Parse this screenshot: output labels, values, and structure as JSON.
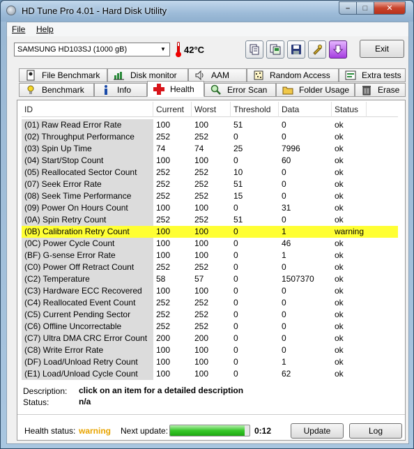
{
  "window": {
    "title": "HD Tune Pro 4.01 - Hard Disk Utility",
    "min_glyph": "–",
    "max_glyph": "□",
    "close_glyph": "✕"
  },
  "menu": {
    "file": "File",
    "help": "Help"
  },
  "toolbar": {
    "drive": "SAMSUNG HD103SJ (1000 gB)",
    "temperature": "42°C",
    "exit_label": "Exit"
  },
  "tabs_top": [
    {
      "label": "File Benchmark",
      "icon": "file-benchmark-icon"
    },
    {
      "label": "Disk monitor",
      "icon": "disk-monitor-icon"
    },
    {
      "label": "AAM",
      "icon": "speaker-icon"
    },
    {
      "label": "Random Access",
      "icon": "random-access-icon"
    },
    {
      "label": "Extra tests",
      "icon": "extra-tests-icon"
    }
  ],
  "tabs_bottom": [
    {
      "label": "Benchmark",
      "icon": "bulb-icon"
    },
    {
      "label": "Info",
      "icon": "info-icon"
    },
    {
      "label": "Health",
      "icon": "health-cross-icon",
      "active": true
    },
    {
      "label": "Error Scan",
      "icon": "magnifier-icon"
    },
    {
      "label": "Folder Usage",
      "icon": "folder-icon"
    },
    {
      "label": "Erase",
      "icon": "trash-icon"
    }
  ],
  "columns": [
    "ID",
    "Current",
    "Worst",
    "Threshold",
    "Data",
    "Status"
  ],
  "rows": [
    {
      "id": "(01) Raw Read Error Rate",
      "current": "100",
      "worst": "100",
      "threshold": "51",
      "data": "0",
      "status": "ok"
    },
    {
      "id": "(02) Throughput Performance",
      "current": "252",
      "worst": "252",
      "threshold": "0",
      "data": "0",
      "status": "ok"
    },
    {
      "id": "(03) Spin Up Time",
      "current": "74",
      "worst": "74",
      "threshold": "25",
      "data": "7996",
      "status": "ok"
    },
    {
      "id": "(04) Start/Stop Count",
      "current": "100",
      "worst": "100",
      "threshold": "0",
      "data": "60",
      "status": "ok"
    },
    {
      "id": "(05) Reallocated Sector Count",
      "current": "252",
      "worst": "252",
      "threshold": "10",
      "data": "0",
      "status": "ok"
    },
    {
      "id": "(07) Seek Error Rate",
      "current": "252",
      "worst": "252",
      "threshold": "51",
      "data": "0",
      "status": "ok"
    },
    {
      "id": "(08) Seek Time Performance",
      "current": "252",
      "worst": "252",
      "threshold": "15",
      "data": "0",
      "status": "ok"
    },
    {
      "id": "(09) Power On Hours Count",
      "current": "100",
      "worst": "100",
      "threshold": "0",
      "data": "31",
      "status": "ok"
    },
    {
      "id": "(0A) Spin Retry Count",
      "current": "252",
      "worst": "252",
      "threshold": "51",
      "data": "0",
      "status": "ok"
    },
    {
      "id": "(0B) Calibration Retry Count",
      "current": "100",
      "worst": "100",
      "threshold": "0",
      "data": "1",
      "status": "warning"
    },
    {
      "id": "(0C) Power Cycle Count",
      "current": "100",
      "worst": "100",
      "threshold": "0",
      "data": "46",
      "status": "ok"
    },
    {
      "id": "(BF) G-sense Error Rate",
      "current": "100",
      "worst": "100",
      "threshold": "0",
      "data": "1",
      "status": "ok"
    },
    {
      "id": "(C0) Power Off Retract Count",
      "current": "252",
      "worst": "252",
      "threshold": "0",
      "data": "0",
      "status": "ok"
    },
    {
      "id": "(C2) Temperature",
      "current": "58",
      "worst": "57",
      "threshold": "0",
      "data": "1507370",
      "status": "ok"
    },
    {
      "id": "(C3) Hardware ECC Recovered",
      "current": "100",
      "worst": "100",
      "threshold": "0",
      "data": "0",
      "status": "ok"
    },
    {
      "id": "(C4) Reallocated Event Count",
      "current": "252",
      "worst": "252",
      "threshold": "0",
      "data": "0",
      "status": "ok"
    },
    {
      "id": "(C5) Current Pending Sector",
      "current": "252",
      "worst": "252",
      "threshold": "0",
      "data": "0",
      "status": "ok"
    },
    {
      "id": "(C6) Offline Uncorrectable",
      "current": "252",
      "worst": "252",
      "threshold": "0",
      "data": "0",
      "status": "ok"
    },
    {
      "id": "(C7) Ultra DMA CRC Error Count",
      "current": "200",
      "worst": "200",
      "threshold": "0",
      "data": "0",
      "status": "ok"
    },
    {
      "id": "(C8) Write Error Rate",
      "current": "100",
      "worst": "100",
      "threshold": "0",
      "data": "0",
      "status": "ok"
    },
    {
      "id": "(DF) Load/Unload Retry Count",
      "current": "100",
      "worst": "100",
      "threshold": "0",
      "data": "1",
      "status": "ok"
    },
    {
      "id": "(E1) Load/Unload Cycle Count",
      "current": "100",
      "worst": "100",
      "threshold": "0",
      "data": "62",
      "status": "ok"
    }
  ],
  "description": {
    "label": "Description:",
    "value": "click on an item for a detailed description",
    "status_label": "Status:",
    "status_value": "n/a"
  },
  "footer": {
    "health_label": "Health status:",
    "health_value": "warning",
    "health_color": "#e8a400",
    "next_label": "Next update:",
    "next_value": "0:12",
    "progress": 0.94,
    "update_label": "Update",
    "log_label": "Log"
  }
}
